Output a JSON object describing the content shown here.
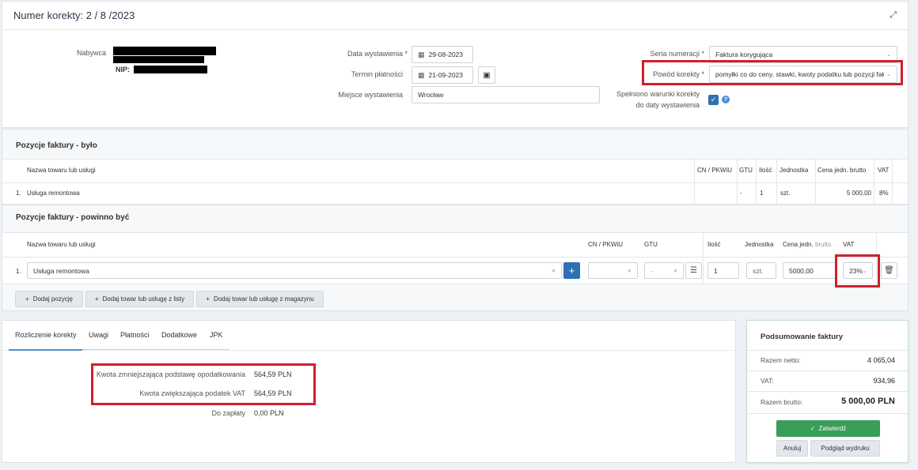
{
  "header": {
    "title": "Numer korekty: 2 / 8 /2023"
  },
  "form": {
    "buyer_label": "Nabywca",
    "nip_label": "NIP:",
    "issue_date_label": "Data wystawienia *",
    "issue_date_value": "29-08-2023",
    "payment_date_label": "Termin płatności",
    "payment_date_value": "21-09-2023",
    "place_label": "Miejsce wystawienia",
    "place_value": "Wrocław",
    "series_label": "Seria numeracji *",
    "series_value": "Faktura korygująca",
    "reason_label": "Powód korekty *",
    "reason_value": "pomyłki co do ceny, stawki, kwoty podatku lub pozycji faktur",
    "conditions_label_1": "Spełniono warunki korekty",
    "conditions_label_2": "do daty wystawienia"
  },
  "was": {
    "title": "Pozycje faktury - było",
    "headers": [
      "Nazwa towaru lub usługi",
      "CN / PKWiU",
      "GTU",
      "Ilość",
      "Jednostka",
      "Cena jedn. brutto",
      "VAT"
    ],
    "row": {
      "num": "1.",
      "name": "Usługa remontowa",
      "gtu": "-",
      "qty": "1",
      "unit": "szt.",
      "price": "5 000,00",
      "vat": "8%"
    }
  },
  "should": {
    "title": "Pozycje faktury - powinno być",
    "headers": {
      "name": "Nazwa towaru lub usługi",
      "cn": "CN / PKWiU",
      "gtu": "GTU",
      "qty": "Ilość",
      "unit": "Jednostka",
      "price": "Cena jedn.",
      "price_suffix": "brutto",
      "vat": "VAT"
    },
    "row": {
      "num": "1.",
      "name": "Usługa remontowa",
      "gtu": "-",
      "qty": "1",
      "unit": "szt.",
      "price": "5000,00",
      "vat": "23%"
    },
    "buttons": {
      "add_position": "Dodaj pozycję",
      "add_from_list": "Dodaj towar lub usługę z listy",
      "add_from_warehouse": "Dodaj towar lub usługę z magazynu"
    }
  },
  "tabs": [
    "Rozliczenie korekty",
    "Uwagi",
    "Płatności",
    "Dodatkowe",
    "JPK"
  ],
  "settlement": {
    "decrease_label": "Kwota zmniejszająca podstawę opodatkowania",
    "decrease_value": "564,59 PLN",
    "increase_label": "Kwota zwiększająca podatek VAT",
    "increase_value": "564,59 PLN",
    "to_pay_label": "Do zapłaty",
    "to_pay_value": "0,00 PLN"
  },
  "summary": {
    "title": "Podsumowanie faktury",
    "net_label": "Razem netto:",
    "net_value": "4 065,04",
    "vat_label": "VAT:",
    "vat_value": "934,96",
    "gross_label": "Razem brutto:",
    "gross_value": "5 000,00 PLN",
    "approve": "Zatwierdź",
    "cancel": "Anuluj",
    "preview": "Podgląd wydruku"
  },
  "colors": {
    "highlight": "#d01f2e",
    "primary": "#2f6fb5",
    "success": "#3a9d5a"
  }
}
